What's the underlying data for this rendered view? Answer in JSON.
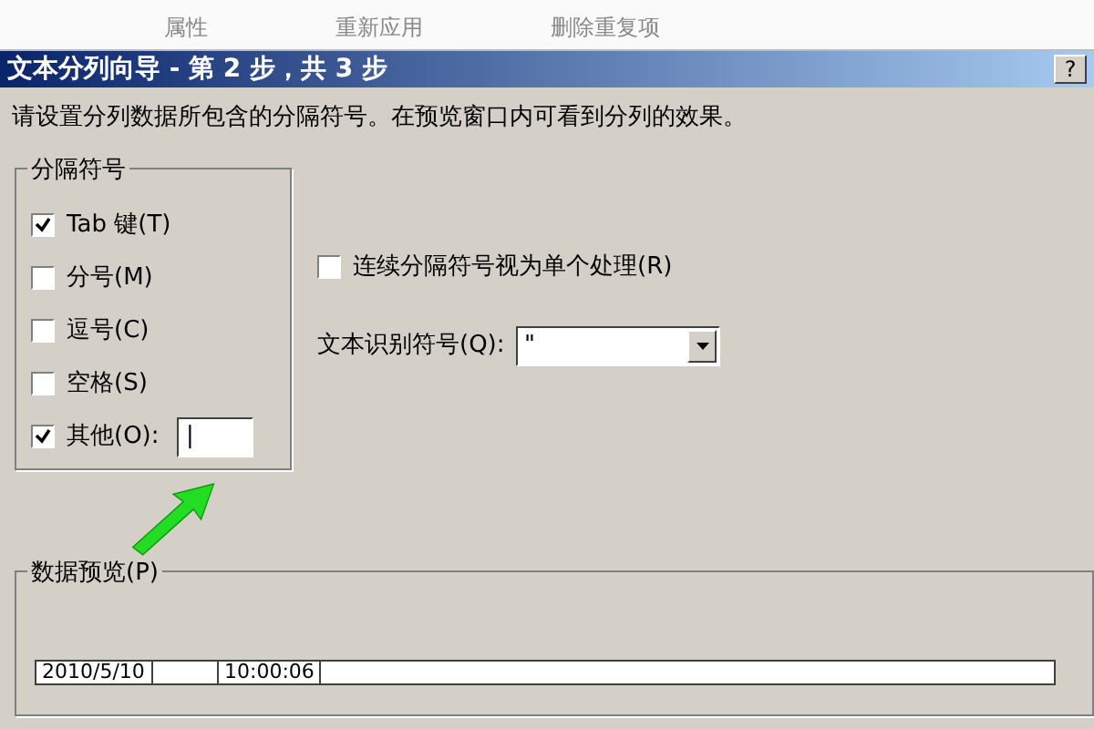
{
  "toolbar": {
    "items": [
      {
        "label": "属性"
      },
      {
        "label": "重新应用"
      },
      {
        "label": "删除重复项"
      }
    ]
  },
  "window": {
    "title": "文本分列向导 - 第 2 步，共 3 步",
    "help_button": "?"
  },
  "instruction": "请设置分列数据所包含的分隔符号。在预览窗口内可看到分列的效果。",
  "delimiters": {
    "title": "分隔符号",
    "items": [
      {
        "label": "Tab 键(T)",
        "checked": true
      },
      {
        "label": "分号(M)",
        "checked": false
      },
      {
        "label": "逗号(C)",
        "checked": false
      },
      {
        "label": "空格(S)",
        "checked": false
      },
      {
        "label": "其他(O):",
        "checked": true,
        "kind": "other",
        "value": "|"
      }
    ]
  },
  "consecutive": {
    "label": "连续分隔符号视为单个处理(R)",
    "checked": false
  },
  "qualifier": {
    "label": "文本识别符号(Q):",
    "value": "\""
  },
  "preview": {
    "title": "数据预览(P)",
    "rows": [
      [
        "2010/5/10",
        "",
        "10:00:06"
      ]
    ]
  }
}
